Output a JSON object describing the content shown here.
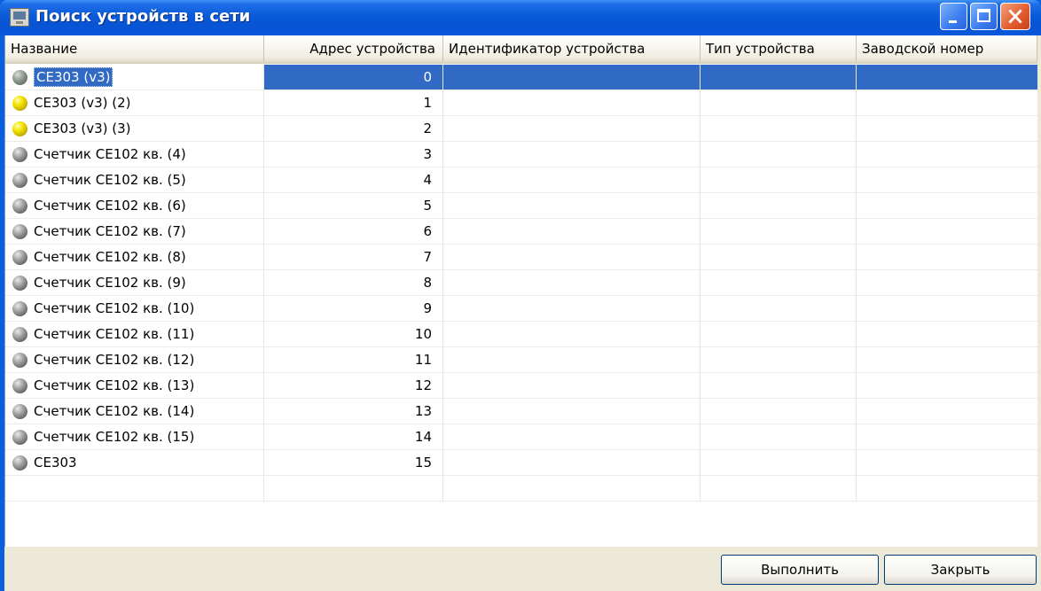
{
  "window": {
    "title": "Поиск устройств в сети",
    "icon": "network-search-icon",
    "controls": [
      "minimize-icon",
      "maximize-icon",
      "close-icon"
    ]
  },
  "columns": [
    "Название",
    "Адрес устройства",
    "Идентификатор устройства",
    "Тип устройства",
    "Заводской номер"
  ],
  "rows": [
    {
      "name": "CE303 (v3)",
      "addr": "0",
      "status": "gray",
      "selected": true
    },
    {
      "name": "CE303 (v3) (2)",
      "addr": "1",
      "status": "yellow"
    },
    {
      "name": "CE303 (v3) (3)",
      "addr": "2",
      "status": "yellow"
    },
    {
      "name": "Счетчик CE102 кв. (4)",
      "addr": "3",
      "status": "gray"
    },
    {
      "name": "Счетчик CE102 кв. (5)",
      "addr": "4",
      "status": "gray"
    },
    {
      "name": "Счетчик CE102 кв. (6)",
      "addr": "5",
      "status": "gray"
    },
    {
      "name": "Счетчик CE102 кв. (7)",
      "addr": "6",
      "status": "gray"
    },
    {
      "name": "Счетчик CE102 кв. (8)",
      "addr": "7",
      "status": "gray"
    },
    {
      "name": "Счетчик CE102 кв. (9)",
      "addr": "8",
      "status": "gray"
    },
    {
      "name": "Счетчик CE102 кв. (10)",
      "addr": "9",
      "status": "gray"
    },
    {
      "name": "Счетчик CE102 кв. (11)",
      "addr": "10",
      "status": "gray"
    },
    {
      "name": "Счетчик CE102 кв. (12)",
      "addr": "11",
      "status": "gray"
    },
    {
      "name": "Счетчик CE102 кв. (13)",
      "addr": "12",
      "status": "gray"
    },
    {
      "name": "Счетчик CE102 кв. (14)",
      "addr": "13",
      "status": "gray"
    },
    {
      "name": "Счетчик CE102 кв. (15)",
      "addr": "14",
      "status": "gray"
    },
    {
      "name": "CE303",
      "addr": "15",
      "status": "gray"
    }
  ],
  "buttons": {
    "run": "Выполнить",
    "close": "Закрыть"
  },
  "colors": {
    "titlebar": "#0a5ad9",
    "selection": "#316ac5",
    "led_yellow": "#f3e300",
    "led_gray": "#8a8a8a"
  }
}
